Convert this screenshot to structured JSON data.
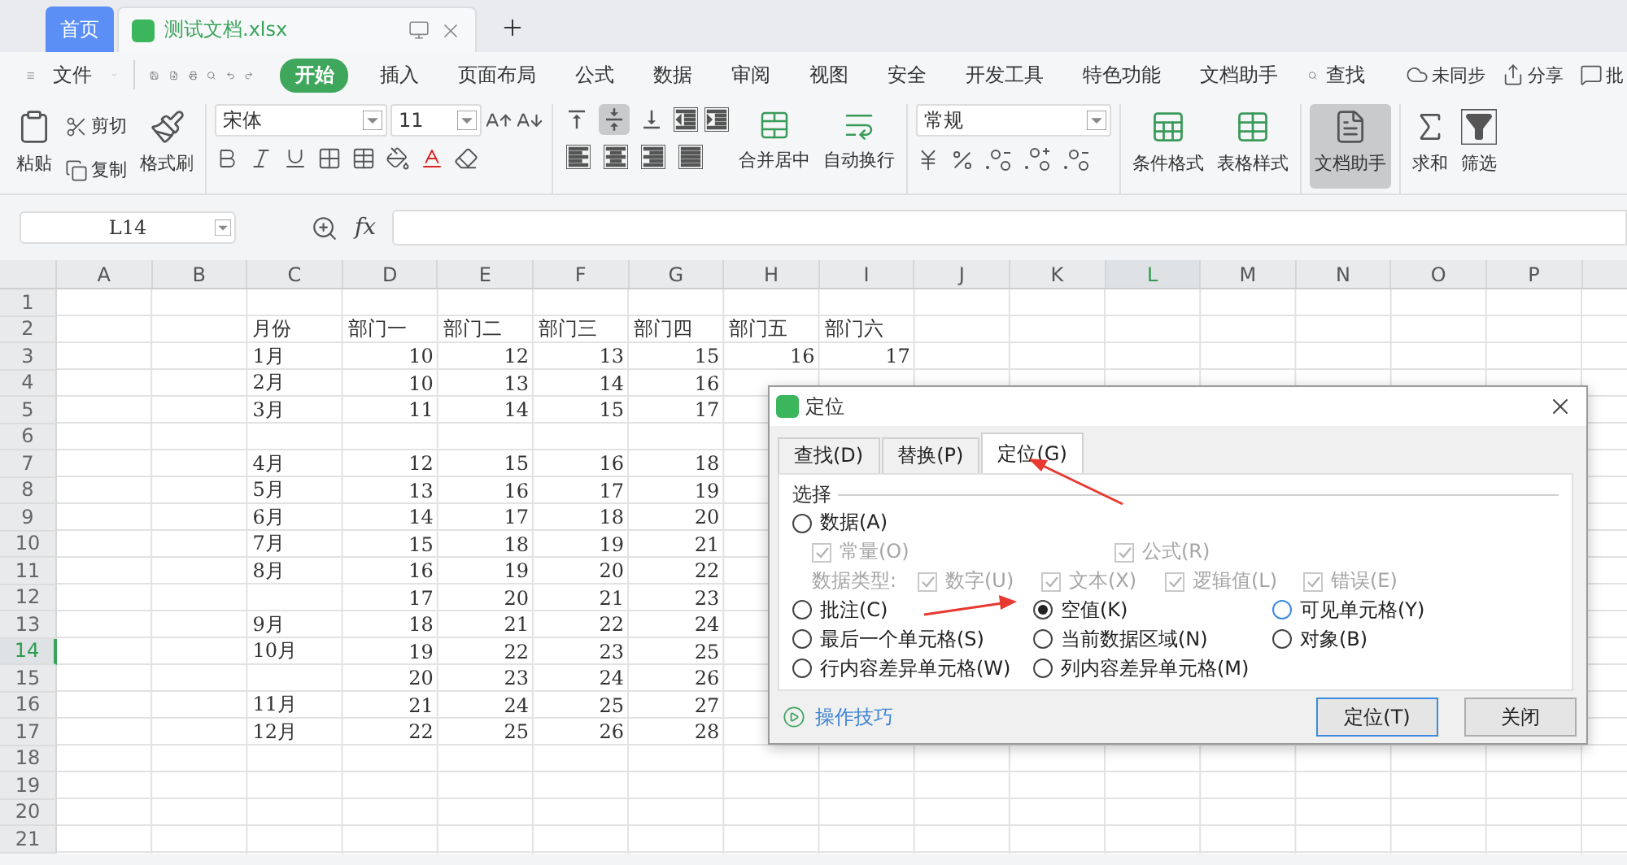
{
  "tabs": [
    {
      "kind": "home",
      "label": "首页",
      "selected": false
    },
    {
      "kind": "file",
      "label": "测试文档.xlsx",
      "selected": true
    }
  ],
  "menu": {
    "file": "文件",
    "items": [
      {
        "label": "开始",
        "selected": true
      },
      {
        "label": "插入",
        "selected": false
      },
      {
        "label": "页面布局",
        "selected": false
      },
      {
        "label": "公式",
        "selected": false
      },
      {
        "label": "数据",
        "selected": false
      },
      {
        "label": "审阅",
        "selected": false
      },
      {
        "label": "视图",
        "selected": false
      },
      {
        "label": "安全",
        "selected": false
      },
      {
        "label": "开发工具",
        "selected": false
      },
      {
        "label": "特色功能",
        "selected": false
      },
      {
        "label": "文档助手",
        "selected": false
      }
    ],
    "search": "查找",
    "actions": [
      {
        "kind": "sync",
        "label": "未同步"
      },
      {
        "kind": "share",
        "label": "分享"
      },
      {
        "kind": "comment",
        "label": "批"
      }
    ]
  },
  "ribbon": {
    "paste": "粘贴",
    "cut": "剪切",
    "copy": "复制",
    "format_painter": "格式刷",
    "font_name": "宋体",
    "font_size": "11",
    "valign": [
      {
        "kind": "top",
        "selected": false
      },
      {
        "kind": "middle",
        "selected": true
      },
      {
        "kind": "bottom",
        "selected": false
      }
    ],
    "merge": "合并居中",
    "wrap": "自动换行",
    "number_format": "常规",
    "conditional_format": "条件格式",
    "table_style": "表格样式",
    "assistant": {
      "label": "文档助手",
      "selected": true
    },
    "sum": "求和",
    "filter": "筛选"
  },
  "formula_bar": {
    "name_box": "L14",
    "fx": "fx"
  },
  "sheet": {
    "columns": [
      {
        "label": "A",
        "selected": false
      },
      {
        "label": "B",
        "selected": false
      },
      {
        "label": "C",
        "selected": false
      },
      {
        "label": "D",
        "selected": false
      },
      {
        "label": "E",
        "selected": false
      },
      {
        "label": "F",
        "selected": false
      },
      {
        "label": "G",
        "selected": false
      },
      {
        "label": "H",
        "selected": false
      },
      {
        "label": "I",
        "selected": false
      },
      {
        "label": "J",
        "selected": false
      },
      {
        "label": "K",
        "selected": false
      },
      {
        "label": "L",
        "selected": true
      },
      {
        "label": "M",
        "selected": false
      },
      {
        "label": "N",
        "selected": false
      },
      {
        "label": "O",
        "selected": false
      },
      {
        "label": "P",
        "selected": false
      }
    ],
    "rows": [
      {
        "header": "1",
        "selected": false
      },
      {
        "header": "2",
        "selected": false,
        "kind": "header",
        "cells": [
          "月份",
          "部门一",
          "部门二",
          "部门三",
          "部门四",
          "部门五",
          "部门六"
        ]
      },
      {
        "header": "3",
        "selected": false,
        "kind": "data",
        "cells": [
          "1月",
          "10",
          "12",
          "13",
          "15",
          "16",
          "17"
        ]
      },
      {
        "header": "4",
        "selected": false,
        "kind": "data",
        "cells": [
          "2月",
          "10",
          "13",
          "14",
          "16"
        ]
      },
      {
        "header": "5",
        "selected": false,
        "kind": "data",
        "cells": [
          "3月",
          "11",
          "14",
          "15",
          "17"
        ]
      },
      {
        "header": "6",
        "selected": false
      },
      {
        "header": "7",
        "selected": false,
        "kind": "data",
        "cells": [
          "4月",
          "12",
          "15",
          "16",
          "18"
        ]
      },
      {
        "header": "8",
        "selected": false,
        "kind": "data",
        "cells": [
          "5月",
          "13",
          "16",
          "17",
          "19"
        ]
      },
      {
        "header": "9",
        "selected": false,
        "kind": "data",
        "cells": [
          "6月",
          "14",
          "17",
          "18",
          "20"
        ]
      },
      {
        "header": "10",
        "selected": false,
        "kind": "data",
        "cells": [
          "7月",
          "15",
          "18",
          "19",
          "21"
        ]
      },
      {
        "header": "11",
        "selected": false,
        "kind": "data",
        "cells": [
          "8月",
          "16",
          "19",
          "20",
          "22"
        ]
      },
      {
        "header": "12",
        "selected": false,
        "kind": "data",
        "cells": [
          null,
          "17",
          "20",
          "21",
          "23"
        ]
      },
      {
        "header": "13",
        "selected": false,
        "kind": "data",
        "cells": [
          "9月",
          "18",
          "21",
          "22",
          "24"
        ]
      },
      {
        "header": "14",
        "selected": true,
        "kind": "data",
        "cells": [
          "10月",
          "19",
          "22",
          "23",
          "25"
        ]
      },
      {
        "header": "15",
        "selected": false,
        "kind": "data",
        "cells": [
          null,
          "20",
          "23",
          "24",
          "26"
        ]
      },
      {
        "header": "16",
        "selected": false,
        "kind": "data",
        "cells": [
          "11月",
          "21",
          "24",
          "25",
          "27"
        ]
      },
      {
        "header": "17",
        "selected": false,
        "kind": "data",
        "cells": [
          "12月",
          "22",
          "25",
          "26",
          "28"
        ]
      },
      {
        "header": "18",
        "selected": false
      },
      {
        "header": "19",
        "selected": false
      },
      {
        "header": "20",
        "selected": false
      },
      {
        "header": "21",
        "selected": false
      }
    ]
  },
  "dialog": {
    "title": "定位",
    "tabs": [
      {
        "label": "查找(D)",
        "selected": false
      },
      {
        "label": "替换(P)",
        "selected": false
      },
      {
        "label": "定位(G)",
        "selected": true
      }
    ],
    "section": "选择",
    "rows": [
      {
        "kind": "single",
        "items": [
          {
            "kind": "radio",
            "label": "数据(A)",
            "selected": false,
            "highlighted": false
          }
        ]
      },
      {
        "kind": "pair",
        "items": [
          {
            "kind": "check",
            "label": "常量(O)",
            "checked": true,
            "disabled": true
          },
          {
            "kind": "check",
            "label": "公式(R)",
            "checked": true,
            "disabled": true
          }
        ]
      },
      {
        "kind": "types",
        "items": [
          {
            "kind": "caption",
            "label": "数据类型:"
          },
          {
            "kind": "check",
            "label": "数字(U)",
            "checked": true,
            "disabled": true
          },
          {
            "kind": "check",
            "label": "文本(X)",
            "checked": true,
            "disabled": true
          },
          {
            "kind": "check",
            "label": "逻辑值(L)",
            "checked": true,
            "disabled": true
          },
          {
            "kind": "check",
            "label": "错误(E)",
            "checked": true,
            "disabled": true
          }
        ]
      },
      {
        "kind": "triple",
        "items": [
          {
            "kind": "radio",
            "label": "批注(C)",
            "selected": false,
            "highlighted": false
          },
          {
            "kind": "radio",
            "label": "空值(K)",
            "selected": true,
            "highlighted": false
          },
          {
            "kind": "radio",
            "label": "可见单元格(Y)",
            "selected": false,
            "highlighted": true
          }
        ]
      },
      {
        "kind": "triple",
        "items": [
          {
            "kind": "radio",
            "label": "最后一个单元格(S)",
            "selected": false,
            "highlighted": false
          },
          {
            "kind": "radio",
            "label": "当前数据区域(N)",
            "selected": false,
            "highlighted": false
          },
          {
            "kind": "radio",
            "label": "对象(B)",
            "selected": false,
            "highlighted": false
          }
        ]
      },
      {
        "kind": "triple",
        "items": [
          {
            "kind": "radio",
            "label": "行内容差异单元格(W)",
            "selected": false,
            "highlighted": false
          },
          {
            "kind": "radio",
            "label": "列内容差异单元格(M)",
            "selected": false,
            "highlighted": false
          }
        ]
      }
    ],
    "tips": "操作技巧",
    "buttons": [
      {
        "label": "定位(T)",
        "focused": true
      },
      {
        "label": "关闭",
        "focused": false
      }
    ]
  }
}
